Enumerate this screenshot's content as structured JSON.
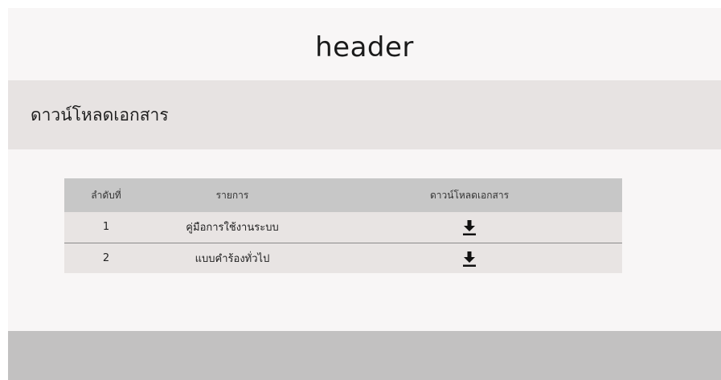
{
  "header": {
    "title": "header"
  },
  "section": {
    "title": "ดาวน์โหลดเอกสาร"
  },
  "table": {
    "columns": [
      "ลำดับที่",
      "รายการ",
      "ดาวน์โหลดเอกสาร"
    ],
    "rows": [
      {
        "index": "1",
        "name": "คู่มือการใช้งานระบบ",
        "download_icon": "download-icon"
      },
      {
        "index": "2",
        "name": "แบบคำร้องทั่วไป",
        "download_icon": "download-icon"
      }
    ]
  },
  "colors": {
    "page_bg": "#f8f6f6",
    "section_bar": "#e7e3e2",
    "table_header": "#c7c7c7",
    "table_row": "#e8e4e3",
    "footer": "#c2c1c1"
  }
}
